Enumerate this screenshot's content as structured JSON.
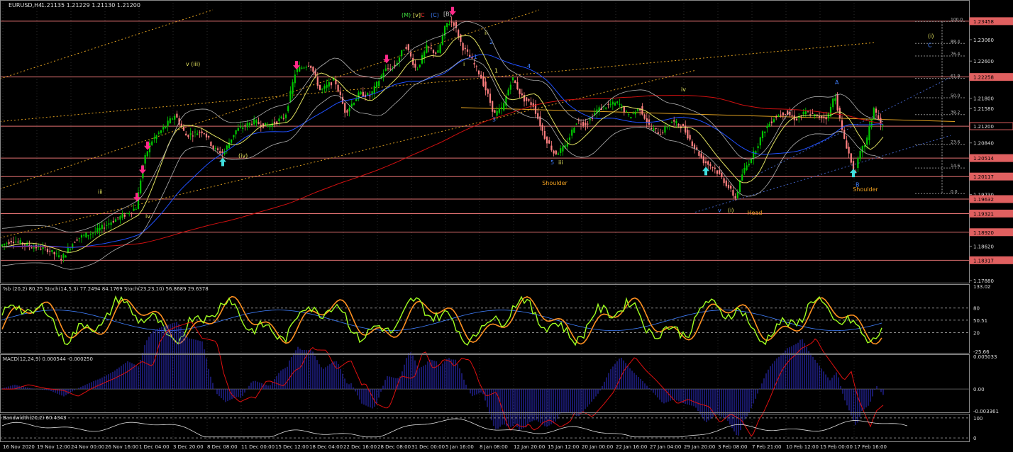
{
  "header": {
    "symbol": "EURUSD,H4",
    "ohlc": "1.21135 1.21229 1.21130 1.21200"
  },
  "colors": {
    "background": "#000000",
    "grid": "#2a2a2a",
    "bull_candle": "#00c800",
    "bear_candle": "#ff8080",
    "hline": "#e07070",
    "ma_long": "#d01010",
    "ma_mid": "#2050ff",
    "ma_short": "#e0e060",
    "bands": "#b0b0b0",
    "channel": "#e0a020",
    "magenta_arrow": "#ff2a8a",
    "cyan_arrow": "#40e0e0",
    "wave_label": "#e8e860",
    "pattern_label": "#f0a020",
    "stoch_k": "#a0ff20",
    "stoch_d": "#ff9020",
    "stoch_slow": "#4080ff",
    "macd_hist": "#3030d0",
    "macd_signal": "#e01010",
    "bandwidth": "#e0e0e0"
  },
  "chart_data": {
    "type": "candlestick",
    "title": "EURUSD,H4",
    "ylim": [
      1.1785,
      1.237
    ],
    "price_tick_labels": [
      "1.23458",
      "1.23060",
      "1.22600",
      "1.22258",
      "1.21800",
      "1.21580",
      "1.21200",
      "1.20840",
      "1.20514",
      "1.20117",
      "1.19730",
      "1.19632",
      "1.19321",
      "1.18920",
      "1.18620",
      "1.18317",
      "1.17880"
    ],
    "highlighted_levels": [
      {
        "value": 1.23458,
        "label": "1.23458"
      },
      {
        "value": 1.22258,
        "label": "1.22258"
      },
      {
        "value": 1.212,
        "label": "1.21200"
      },
      {
        "value": 1.20514,
        "label": "1.20514"
      },
      {
        "value": 1.20117,
        "label": "1.20117"
      },
      {
        "value": 1.19632,
        "label": "1.19632"
      },
      {
        "value": 1.19321,
        "label": "1.19321"
      },
      {
        "value": 1.1892,
        "label": "1.18920"
      },
      {
        "value": 1.18317,
        "label": "1.18317"
      }
    ],
    "x_tick_labels": [
      "16 Nov 2020",
      "19 Nov 12:00",
      "24 Nov 00:00",
      "26 Nov 16:00",
      "1 Dec 04:00",
      "3 Dec 20:00",
      "8 Dec 08:00",
      "11 Dec 00:00",
      "15 Dec 12:00",
      "18 Dec 04:00",
      "22 Dec 16:00",
      "28 Dec 08:00",
      "31 Dec 00:00",
      "5 Jan 16:00",
      "8 Jan 08:00",
      "12 Jan 20:00",
      "15 Jan 12:00",
      "20 Jan 00:00",
      "22 Jan 16:00",
      "27 Jan 04:00",
      "29 Jan 20:00",
      "3 Feb 08:00",
      "7 Feb 21:00",
      "10 Feb 12:00",
      "15 Feb 00:00",
      "17 Feb 16:00"
    ],
    "price_path": [
      [
        0,
        1.186
      ],
      [
        20,
        1.1875
      ],
      [
        45,
        1.1862
      ],
      [
        70,
        1.1855
      ],
      [
        90,
        1.1835
      ],
      [
        110,
        1.1878
      ],
      [
        140,
        1.1895
      ],
      [
        160,
        1.1915
      ],
      [
        180,
        1.193
      ],
      [
        195,
        1.1945
      ],
      [
        205,
        1.204
      ],
      [
        215,
        1.2085
      ],
      [
        235,
        1.2118
      ],
      [
        250,
        1.2145
      ],
      [
        265,
        1.21
      ],
      [
        290,
        1.211
      ],
      [
        305,
        1.207
      ],
      [
        318,
        1.2062
      ],
      [
        335,
        1.211
      ],
      [
        360,
        1.213
      ],
      [
        380,
        1.212
      ],
      [
        405,
        1.214
      ],
      [
        420,
        1.224
      ],
      [
        440,
        1.2255
      ],
      [
        455,
        1.2195
      ],
      [
        475,
        1.222
      ],
      [
        490,
        1.215
      ],
      [
        510,
        1.219
      ],
      [
        525,
        1.2185
      ],
      [
        545,
        1.224
      ],
      [
        560,
        1.225
      ],
      [
        575,
        1.2295
      ],
      [
        590,
        1.224
      ],
      [
        605,
        1.229
      ],
      [
        620,
        1.2275
      ],
      [
        632,
        1.234
      ],
      [
        642,
        1.2345
      ],
      [
        655,
        1.229
      ],
      [
        665,
        1.227
      ],
      [
        680,
        1.223
      ],
      [
        690,
        1.219
      ],
      [
        700,
        1.2145
      ],
      [
        712,
        1.216
      ],
      [
        725,
        1.2225
      ],
      [
        740,
        1.218
      ],
      [
        755,
        1.2165
      ],
      [
        770,
        1.21
      ],
      [
        785,
        1.206
      ],
      [
        800,
        1.2075
      ],
      [
        815,
        1.213
      ],
      [
        830,
        1.2125
      ],
      [
        845,
        1.2155
      ],
      [
        860,
        1.2165
      ],
      [
        875,
        1.217
      ],
      [
        890,
        1.214
      ],
      [
        905,
        1.216
      ],
      [
        920,
        1.2115
      ],
      [
        935,
        1.2105
      ],
      [
        950,
        1.213
      ],
      [
        965,
        1.212
      ],
      [
        980,
        1.208
      ],
      [
        995,
        1.2045
      ],
      [
        1010,
        1.203
      ],
      [
        1025,
        1.2
      ],
      [
        1040,
        1.1965
      ],
      [
        1050,
        1.202
      ],
      [
        1065,
        1.206
      ],
      [
        1080,
        1.211
      ],
      [
        1095,
        1.214
      ],
      [
        1110,
        1.215
      ],
      [
        1125,
        1.2135
      ],
      [
        1140,
        1.215
      ],
      [
        1155,
        1.214
      ],
      [
        1170,
        1.214
      ],
      [
        1180,
        1.219
      ],
      [
        1190,
        1.211
      ],
      [
        1200,
        1.206
      ],
      [
        1207,
        1.2015
      ],
      [
        1215,
        1.206
      ],
      [
        1225,
        1.209
      ],
      [
        1235,
        1.216
      ],
      [
        1245,
        1.212
      ]
    ],
    "wave_labels": [
      {
        "text": "(i)",
        "color": "#e8e860",
        "x": 1308,
        "y": 1.231
      },
      {
        "text": "C",
        "color": "#4080ff",
        "x": 1308,
        "y": 1.229
      },
      {
        "text": "v (iii)",
        "color": "#e8e860",
        "x": 262,
        "y": 1.225
      },
      {
        "text": "iii",
        "color": "#e8e860",
        "x": 138,
        "y": 1.1975
      },
      {
        "text": "iv",
        "color": "#e8e860",
        "x": 205,
        "y": 1.1922
      },
      {
        "text": "(iv)",
        "color": "#e8e860",
        "x": 336,
        "y": 1.2052
      },
      {
        "text": "ii",
        "color": "#e8e860",
        "x": 683,
        "y": 1.2317
      },
      {
        "text": "1",
        "color": "#4080ff",
        "x": 668,
        "y": 1.2265
      },
      {
        "text": "2",
        "color": "#4080ff",
        "x": 690,
        "y": 1.2297
      },
      {
        "text": "i",
        "color": "#e8e860",
        "x": 653,
        "y": 1.225
      },
      {
        "text": "4",
        "color": "#4080ff",
        "x": 743,
        "y": 1.2245
      },
      {
        "text": "1",
        "color": "#e8e860",
        "x": 697,
        "y": 1.2235
      },
      {
        "text": "3",
        "color": "#4080ff",
        "x": 694,
        "y": 1.213
      },
      {
        "text": "5",
        "color": "#4080ff",
        "x": 776,
        "y": 1.2038
      },
      {
        "text": "iii",
        "color": "#e8e860",
        "x": 787,
        "y": 1.2038
      },
      {
        "text": "iv",
        "color": "#e8e860",
        "x": 960,
        "y": 1.2195
      },
      {
        "text": "v",
        "color": "#4080ff",
        "x": 1012,
        "y": 1.1935
      },
      {
        "text": "(i)",
        "color": "#e8e860",
        "x": 1026,
        "y": 1.1935
      },
      {
        "text": "A",
        "color": "#4080ff",
        "x": 1177,
        "y": 1.221
      },
      {
        "text": "B",
        "color": "#4080ff",
        "x": 1206,
        "y": 1.199
      },
      {
        "text": "(M)",
        "color": "#40e040",
        "x": 566,
        "y": 1.2355
      },
      {
        "text": "[v]",
        "color": "#e8e860",
        "x": 582,
        "y": 1.2355
      },
      {
        "text": "C",
        "color": "#ff3030",
        "x": 593,
        "y": 1.2355
      },
      {
        "text": "(C)",
        "color": "#4080ff",
        "x": 607,
        "y": 1.2355
      },
      {
        "text": "[B]",
        "color": "#c0c0c0",
        "x": 625,
        "y": 1.2357
      }
    ],
    "pattern_labels": [
      {
        "text": "Shoulder",
        "x": 782,
        "y": 1.1994
      },
      {
        "text": "Head",
        "x": 1064,
        "y": 1.193
      },
      {
        "text": "Shoulder",
        "x": 1220,
        "y": 1.198
      }
    ],
    "fib_levels": [
      {
        "label": "100.0",
        "y": 1.2345
      },
      {
        "label": "88.4",
        "y": 1.2298
      },
      {
        "label": "76.4",
        "y": 1.2271
      },
      {
        "label": "61.8",
        "y": 1.2223
      },
      {
        "label": "50.0",
        "y": 1.2181
      },
      {
        "label": "38.2",
        "y": 1.2145
      },
      {
        "label": "23.6",
        "y": 1.2081
      },
      {
        "label": "14.6",
        "y": 1.203
      },
      {
        "label": "0.0",
        "y": 1.1975
      }
    ],
    "down_arrows_x": [
      193,
      201,
      208,
      418,
      545,
      638
    ],
    "up_arrows_x": [
      314,
      995,
      1203
    ],
    "stoch_panel": {
      "label": "%b (20,2) 80.25  Stoch(14,5,3) 77.2494 84.1769  Stoch(23,23,10) 56.8689 29.6378",
      "tick_labels": [
        "133.02",
        "80",
        "50.51",
        "20",
        "-25.66"
      ]
    },
    "macd_panel": {
      "label": "MACD(12,24,9) 0.000544 -0.000250",
      "tick_labels": [
        "0.005033",
        "0.00",
        "-0.003361"
      ]
    },
    "bandwidth_panel": {
      "label": "Bandwidth(20,2) 60.4343",
      "tick_labels": [
        "100",
        "0"
      ]
    }
  }
}
